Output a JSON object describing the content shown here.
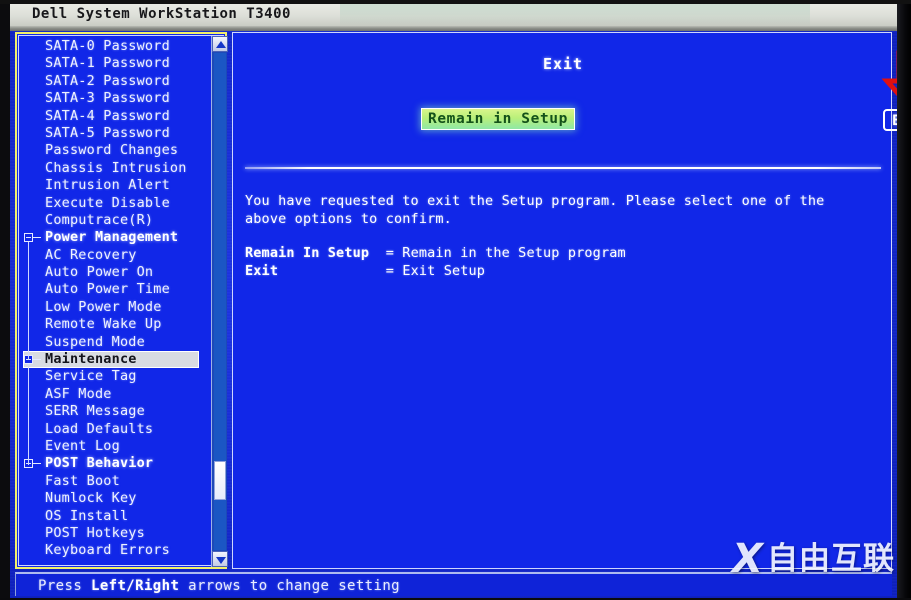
{
  "window": {
    "title": "Dell System WorkStation T3400"
  },
  "colors": {
    "bios_background": "#1127e8",
    "titlebar_background": "#dcdfd8",
    "menu_border": "#f2f06a",
    "selected_item_background": "#d8dbe2",
    "highlight_option_background": "#b9f07a",
    "highlight_option_text": "#14521a",
    "annotation_arrow": "#e01010",
    "text": "#ffffff"
  },
  "menu": {
    "scrollbar": {
      "up_arrow_icon": "scroll-up-arrow-icon",
      "down_arrow_icon": "scroll-down-arrow-icon",
      "thumb_top_percent": 82,
      "thumb_height_percent": 8
    },
    "items": [
      {
        "label": "SATA-0 Password",
        "type": "leaf",
        "selected": false
      },
      {
        "label": "SATA-1 Password",
        "type": "leaf",
        "selected": false
      },
      {
        "label": "SATA-2 Password",
        "type": "leaf",
        "selected": false
      },
      {
        "label": "SATA-3 Password",
        "type": "leaf",
        "selected": false
      },
      {
        "label": "SATA-4 Password",
        "type": "leaf",
        "selected": false
      },
      {
        "label": "SATA-5 Password",
        "type": "leaf",
        "selected": false
      },
      {
        "label": "Password Changes",
        "type": "leaf",
        "selected": false
      },
      {
        "label": "Chassis Intrusion",
        "type": "leaf",
        "selected": false
      },
      {
        "label": "Intrusion Alert",
        "type": "leaf",
        "selected": false
      },
      {
        "label": "Execute Disable",
        "type": "leaf",
        "selected": false
      },
      {
        "label": "Computrace(R)",
        "type": "leaf",
        "selected": false
      },
      {
        "label": "Power Management",
        "type": "group",
        "selected": false,
        "expanded": true
      },
      {
        "label": "AC Recovery",
        "type": "leaf",
        "selected": false
      },
      {
        "label": "Auto Power On",
        "type": "leaf",
        "selected": false
      },
      {
        "label": "Auto Power Time",
        "type": "leaf",
        "selected": false
      },
      {
        "label": "Low Power Mode",
        "type": "leaf",
        "selected": false
      },
      {
        "label": "Remote Wake Up",
        "type": "leaf",
        "selected": false
      },
      {
        "label": "Suspend Mode",
        "type": "leaf",
        "selected": false
      },
      {
        "label": "Maintenance",
        "type": "group",
        "selected": true,
        "expanded": true
      },
      {
        "label": "Service Tag",
        "type": "leaf",
        "selected": false
      },
      {
        "label": "ASF Mode",
        "type": "leaf",
        "selected": false
      },
      {
        "label": "SERR Message",
        "type": "leaf",
        "selected": false
      },
      {
        "label": "Load Defaults",
        "type": "leaf",
        "selected": false
      },
      {
        "label": "Event Log",
        "type": "leaf",
        "selected": false
      },
      {
        "label": "POST Behavior",
        "type": "group",
        "selected": false,
        "expanded": true
      },
      {
        "label": "Fast Boot",
        "type": "leaf",
        "selected": false
      },
      {
        "label": "Numlock Key",
        "type": "leaf",
        "selected": false
      },
      {
        "label": "OS Install",
        "type": "leaf",
        "selected": false
      },
      {
        "label": "POST Hotkeys",
        "type": "leaf",
        "selected": false
      },
      {
        "label": "Keyboard Errors",
        "type": "leaf",
        "selected": false
      }
    ]
  },
  "pane": {
    "title": "Exit",
    "options": [
      {
        "label": "Remain in Setup",
        "state": "highlighted"
      },
      {
        "label": "Exit",
        "state": "focused"
      }
    ],
    "annotation": {
      "icon": "red-down-arrow-icon",
      "points_at": "Exit"
    },
    "description": "You have requested to exit the Setup program. Please select one of the\nabove options to confirm.",
    "legend": [
      {
        "term": "Remain In Setup",
        "separator": "=",
        "definition": "Remain in the Setup program"
      },
      {
        "term": "Exit",
        "separator": "=",
        "definition": "Exit Setup"
      }
    ]
  },
  "statusbar": {
    "prefix": "Press ",
    "keys": "Left/Right",
    "suffix": " arrows to change setting"
  },
  "watermark": {
    "logo_icon": "x-logo-icon",
    "logo_text": "X",
    "text": "自由互联"
  }
}
